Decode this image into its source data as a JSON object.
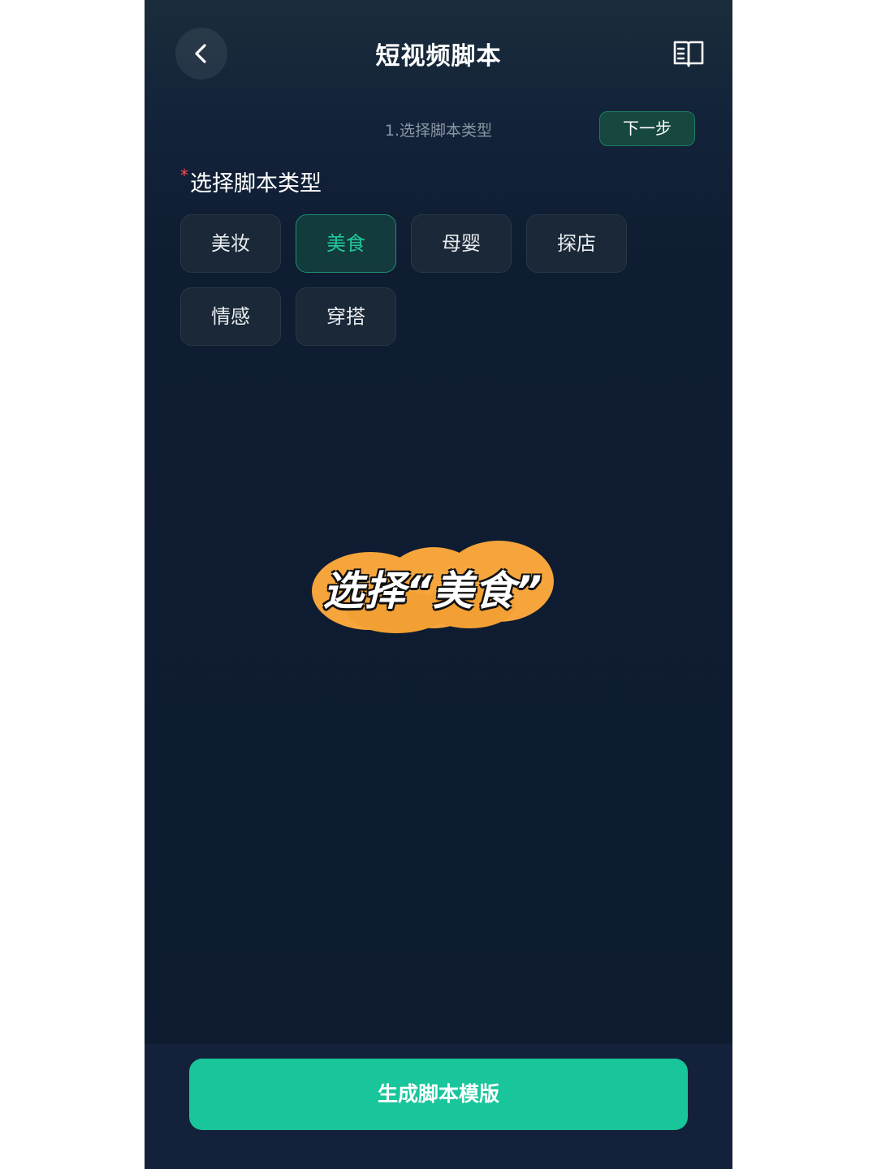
{
  "header": {
    "title": "短视频脚本",
    "back_icon": "chevron-left-icon",
    "guide_icon": "book-icon"
  },
  "step": {
    "label": "1.选择脚本类型",
    "next_label": "下一步"
  },
  "section": {
    "required_mark": "*",
    "title": "选择脚本类型"
  },
  "categories": [
    {
      "label": "美妆",
      "selected": false
    },
    {
      "label": "美食",
      "selected": true
    },
    {
      "label": "母婴",
      "selected": false
    },
    {
      "label": "探店",
      "selected": false
    },
    {
      "label": "情感",
      "selected": false
    },
    {
      "label": "穿搭",
      "selected": false
    }
  ],
  "annotation": {
    "text": "选择“美食”",
    "highlight_color": "#f5a53c"
  },
  "footer": {
    "generate_label": "生成脚本模版"
  },
  "colors": {
    "accent": "#19c59a",
    "background": "#0f1d32"
  }
}
